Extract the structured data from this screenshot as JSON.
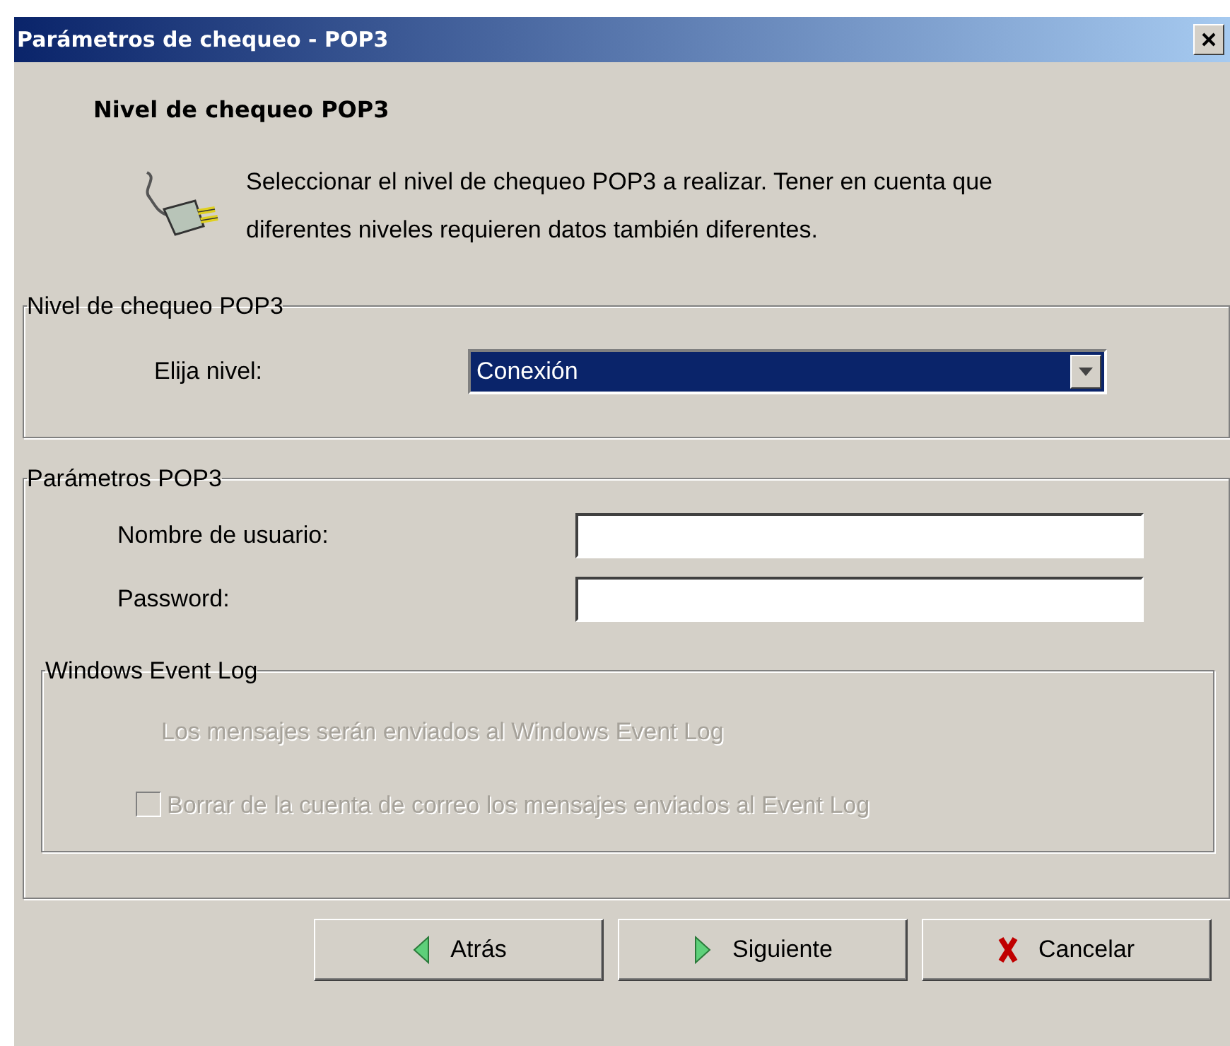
{
  "window": {
    "title": "Parámetros de chequeo - POP3"
  },
  "header": {
    "title": "Nivel de chequeo POP3",
    "description": "Seleccionar el nivel de chequeo POP3 a realizar. Tener en cuenta que diferentes niveles requieren datos también diferentes."
  },
  "level_group": {
    "legend": "Nivel de chequeo POP3",
    "label": "Elija nivel:",
    "value": "Conexión"
  },
  "params_group": {
    "legend": "Parámetros POP3",
    "fields": [
      {
        "label": "Nombre de usuario:"
      },
      {
        "label": "Password:"
      }
    ],
    "event_log": {
      "legend": "Windows Event Log",
      "disabled": true,
      "message": "Los mensajes serán enviados al Windows Event Log",
      "checkbox": {
        "label": "Borrar de la cuenta de correo los mensajes enviados al Event Log",
        "checked": false,
        "disabled": true
      }
    }
  },
  "buttons": [
    {
      "label": "Atrás",
      "kind": "back"
    },
    {
      "label": "Siguiente",
      "kind": "next"
    },
    {
      "label": "Cancelar",
      "kind": "cancel"
    }
  ]
}
